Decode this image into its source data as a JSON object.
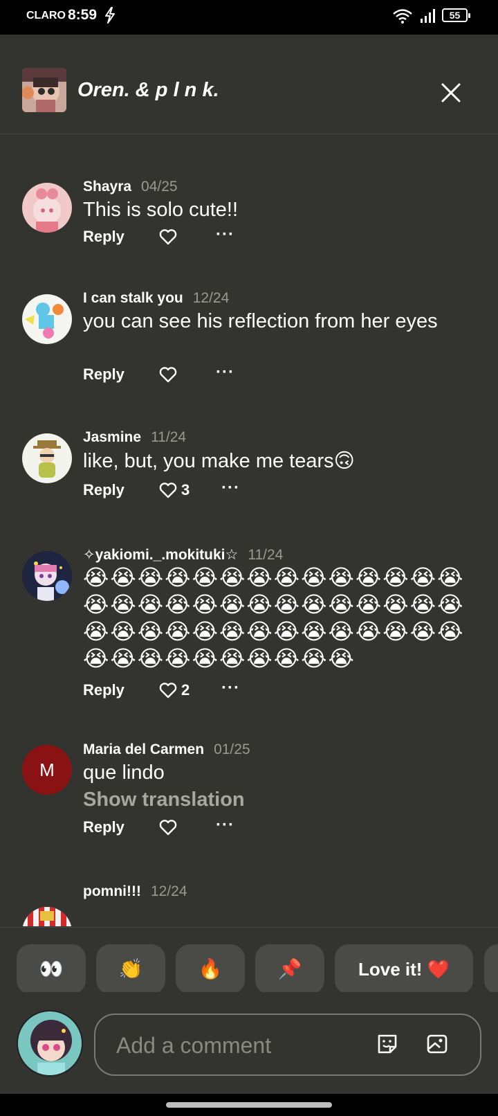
{
  "status_bar": {
    "carrier": "CLARO",
    "time": "8:59",
    "battery": "55"
  },
  "header": {
    "title": "Oren. & p l n k.",
    "close_icon": "close-icon"
  },
  "comments": [
    {
      "user": "Shayra",
      "date": "04/25",
      "text": "This is solo cute!!",
      "reply_label": "Reply",
      "likes": ""
    },
    {
      "user": "I can stalk you",
      "date": "12/24",
      "text": "you can see his reflection from her eyes",
      "reply_label": "Reply",
      "likes": ""
    },
    {
      "user": "Jasmine",
      "date": "11/24",
      "text": "like, but, you make me tears🙃",
      "reply_label": "Reply",
      "likes": "3"
    },
    {
      "user": "✧yakiomi._.mokituki☆",
      "date": "11/24",
      "text": "😭😭😭😭😭😭😭😭😭😭😭😭😭😭😭😭😭😭😭😭😭😭😭😭😭😭😭😭😭😭😭😭😭😭😭😭😭😭😭😭😭😭😭😭😭😭😭😭😭😭😭😭",
      "reply_label": "Reply",
      "likes": "2"
    },
    {
      "user": "Maria del Carmen",
      "date": "01/25",
      "text": "que lindo",
      "translation_label": "Show translation",
      "avatar_letter": "M",
      "reply_label": "Reply",
      "likes": ""
    },
    {
      "user": "pomni!!!",
      "date": "12/24"
    }
  ],
  "reactions": [
    "👀",
    "👏",
    "🔥",
    "📌",
    "Love it! ❤️"
  ],
  "composer": {
    "placeholder": "Add a comment"
  },
  "colors": {
    "background": "#33332f",
    "chip": "#4a4a46",
    "muted": "#9a9a94",
    "avatar_m": "#8b1212"
  }
}
